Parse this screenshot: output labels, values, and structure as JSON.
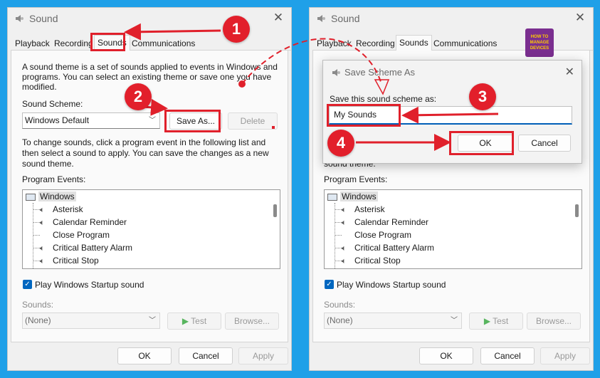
{
  "colors": {
    "background": "#1fa0e8",
    "annotation_red": "#e0202b",
    "checkbox_blue": "#0067c0",
    "focus_blue": "#005fb8"
  },
  "window_title": "Sound",
  "tabs": [
    "Playback",
    "Recording",
    "Sounds",
    "Communications"
  ],
  "description": [
    "A sound theme is a set of sounds applied to events in Windows and",
    "programs. You can select an existing theme or save one you have",
    "modified."
  ],
  "sound_scheme_label": "Sound Scheme:",
  "sound_scheme_value": "Windows Default",
  "save_as_label": "Save As...",
  "delete_label": "Delete",
  "change_text": [
    "To change sounds, click a program event in the following list and",
    "then select a sound to apply. You can save the changes as a new",
    "sound theme."
  ],
  "right_change_tail": "sound theme.",
  "program_events_label": "Program Events:",
  "events_root": "Windows",
  "events": [
    {
      "label": "Asterisk",
      "icon": "speaker-icon"
    },
    {
      "label": "Calendar Reminder",
      "icon": "speaker-icon"
    },
    {
      "label": "Close Program",
      "icon": ""
    },
    {
      "label": "Critical Battery Alarm",
      "icon": "speaker-icon"
    },
    {
      "label": "Critical Stop",
      "icon": "speaker-icon"
    }
  ],
  "startup_label": "Play Windows Startup sound",
  "sounds_label": "Sounds:",
  "sounds_value": "(None)",
  "test_label": "Test",
  "browse_label": "Browse...",
  "footer": {
    "ok": "OK",
    "cancel": "Cancel",
    "apply": "Apply"
  },
  "dialog": {
    "title": "Save Scheme As",
    "prompt": "Save this sound scheme as:",
    "value": "My Sounds",
    "ok": "OK",
    "cancel": "Cancel"
  },
  "logo_lines": [
    "HOW TO",
    "MANAGE",
    "DEVICES"
  ],
  "steps": [
    "1",
    "2",
    "3",
    "4"
  ]
}
